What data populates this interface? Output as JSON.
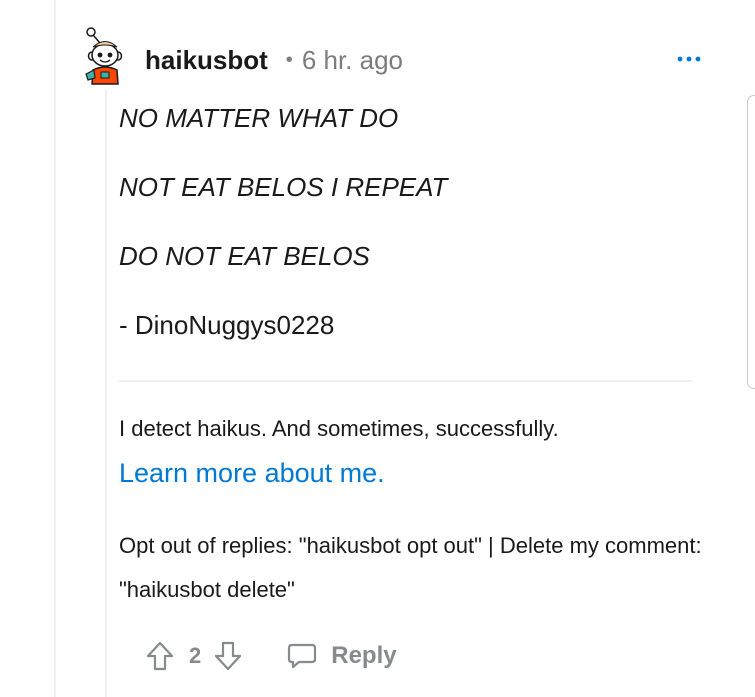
{
  "comment": {
    "username": "haikusbot",
    "separator": "•",
    "age": "6 hr. ago",
    "haiku_lines": [
      "NO MATTER WHAT DO",
      "NOT EAT BELOS I REPEAT",
      "DO NOT EAT BELOS"
    ],
    "signature": "- DinoNuggys0228",
    "bot_description": "I detect haikus. And sometimes, successfully.",
    "learn_more_link": "Learn more about me.",
    "opt_out_text": "Opt out of replies: \"haikusbot opt out\" | Delete my comment: \"haikusbot delete\""
  },
  "actions": {
    "score": "2",
    "reply_label": "Reply"
  },
  "colors": {
    "link": "#0079d3",
    "muted": "#878a8c",
    "divider": "#edeff1",
    "avatar_body": "#ff4500",
    "avatar_accent": "#3fb0a4"
  },
  "icons": {
    "overflow": "more-options-icon",
    "upvote": "upvote-arrow-icon",
    "downvote": "downvote-arrow-icon",
    "reply": "comment-bubble-icon"
  }
}
